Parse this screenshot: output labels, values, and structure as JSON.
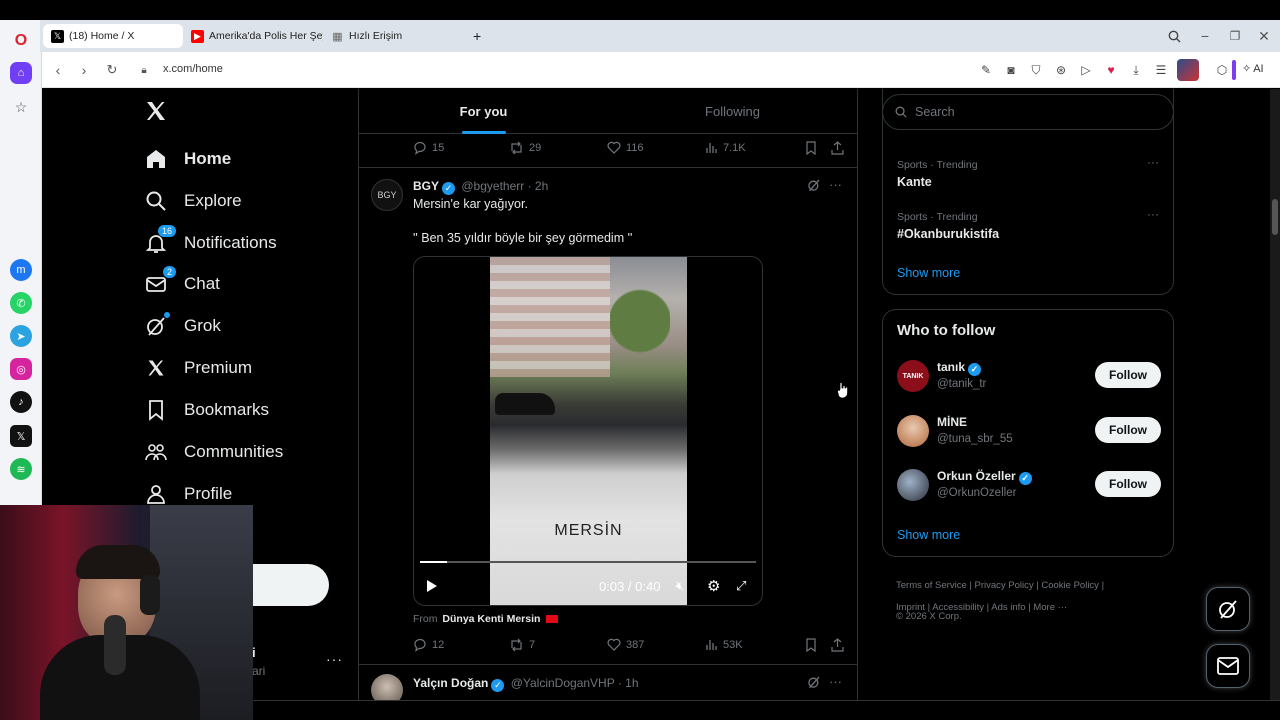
{
  "browser": {
    "tabs": [
      {
        "label": "(18) Home / X",
        "icon": "x-logo-icon"
      },
      {
        "label": "Amerika'da Polis Her Şeyi",
        "icon": "youtube-icon"
      },
      {
        "label": "Hızlı Erişim",
        "icon": "speed-dial-icon"
      }
    ],
    "address": "x.com/home",
    "ai_label": "AI"
  },
  "x": {
    "nav": {
      "home": "Home",
      "explore": "Explore",
      "notifications": "Notifications",
      "notifications_badge": "16",
      "chat": "Chat",
      "chat_badge": "2",
      "grok": "Grok",
      "premium": "Premium",
      "bookmarks": "Bookmarks",
      "communities": "Communities",
      "profile": "Profile",
      "account_initial": "i",
      "account_handle_fragment": "ari"
    },
    "feed_tabs": {
      "for_you": "For you",
      "following": "Following"
    },
    "prev_post_actions": {
      "replies": "15",
      "reposts": "29",
      "likes": "116",
      "views": "7.1K"
    },
    "post": {
      "name": "BGY",
      "handle": "@bgyetherr",
      "time": "· 2h",
      "line1": "Mersin'e kar yağıyor.",
      "line2": "'' Ben 35 yıldır böyle bir şey görmedim ''",
      "video_caption": "MERSİN",
      "video_time": "0:03 / 0:40",
      "video_progress": 0.08,
      "from_label": "From",
      "from_source": "Dünya Kenti Mersin",
      "actions": {
        "replies": "12",
        "reposts": "7",
        "likes": "387",
        "views": "53K"
      }
    },
    "next_post": {
      "name": "Yalçın Doğan",
      "handle": "@YalcinDoganVHP",
      "time": "· 1h"
    },
    "search_placeholder": "Search",
    "trends": [
      {
        "meta": "Sports · Trending",
        "title": "Kante"
      },
      {
        "meta": "Sports · Trending",
        "title": "#Okanburukistifa"
      }
    ],
    "trends_show_more": "Show more",
    "who_to_follow": {
      "title": "Who to follow",
      "users": [
        {
          "name": "tanık",
          "handle": "@tanik_tr",
          "avatar_text": "TANIK",
          "verified": true
        },
        {
          "name": "MİNE",
          "handle": "@tuna_sbr_55",
          "verified": false
        },
        {
          "name": "Orkun Özeller",
          "handle": "@OrkunOzeller",
          "verified": true
        }
      ],
      "follow_label": "Follow",
      "show_more": "Show more"
    },
    "footer": {
      "terms": "Terms of Service",
      "privacy": "Privacy Policy",
      "cookie": "Cookie Policy",
      "imprint": "Imprint",
      "accessibility": "Accessibility",
      "ads": "Ads info",
      "more": "More ···",
      "copyright": "© 2026 X Corp."
    }
  },
  "colors": {
    "accent": "#1d9bf0",
    "border": "#2f3336",
    "muted": "#71767b"
  }
}
